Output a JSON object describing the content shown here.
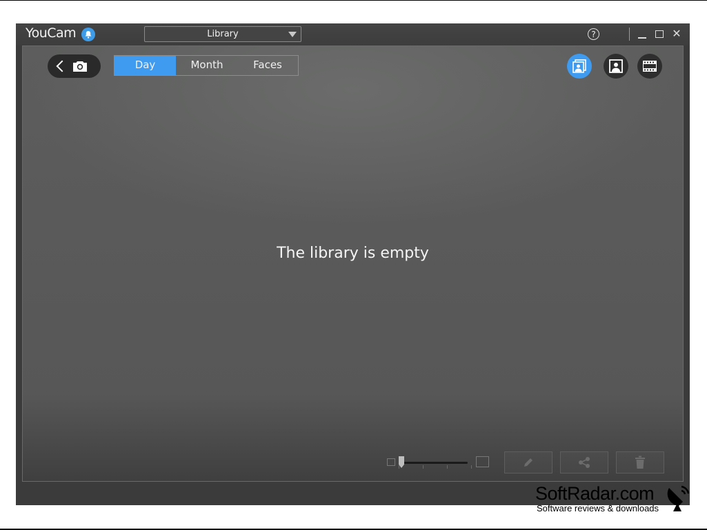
{
  "app": {
    "title": "YouCam",
    "mode_selector": "Library"
  },
  "toolbar": {
    "tabs": [
      {
        "label": "Day",
        "active": true
      },
      {
        "label": "Month",
        "active": false
      },
      {
        "label": "Faces",
        "active": false
      }
    ],
    "view_buttons": [
      {
        "icon": "library-all-icon",
        "active": true
      },
      {
        "icon": "photo-icon",
        "active": false
      },
      {
        "icon": "video-film-icon",
        "active": false
      }
    ]
  },
  "main": {
    "empty_message": "The library is empty"
  },
  "bottom_actions": [
    "edit-pencil-icon",
    "share-icon",
    "trash-icon"
  ],
  "watermark": {
    "title": "SoftRadar.com",
    "subtitle": "Software reviews & downloads"
  },
  "colors": {
    "accent": "#3f9bf0",
    "window_bg": "#3b3b3b",
    "content_bg": "#5a5a5a"
  }
}
